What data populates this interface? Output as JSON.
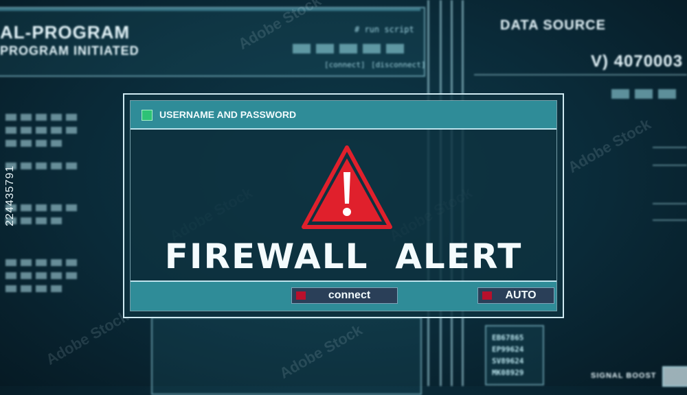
{
  "background": {
    "top_left_panel": {
      "title": "AL-PROGRAM",
      "subtitle": "PROGRAM INITIATED",
      "run_label": "# run script",
      "connect_label": "[connect]",
      "disconnect_label": "[disconnect]"
    },
    "top_right_panel": {
      "title": "DATA SOURCE",
      "value": "V) 4070003"
    },
    "bottom_right_codes": [
      "EB67865",
      "EP99624",
      "SV89624",
      "MK08929"
    ],
    "signal_label": "SIGNAL BOOST"
  },
  "dialog": {
    "title": "USERNAME AND PASSWORD",
    "alert_text": "FIREWALL  ALERT",
    "warning_icon": "warning-triangle-icon",
    "buttons": {
      "connect_label": "connect",
      "auto_label": "AUTO"
    }
  },
  "stock_id": "224435791",
  "watermark": "Adobe Stock",
  "colors": {
    "accent": "#2f8c98",
    "alert_red": "#e0202c",
    "led_green": "#2ec276",
    "led_red": "#b8102c"
  }
}
